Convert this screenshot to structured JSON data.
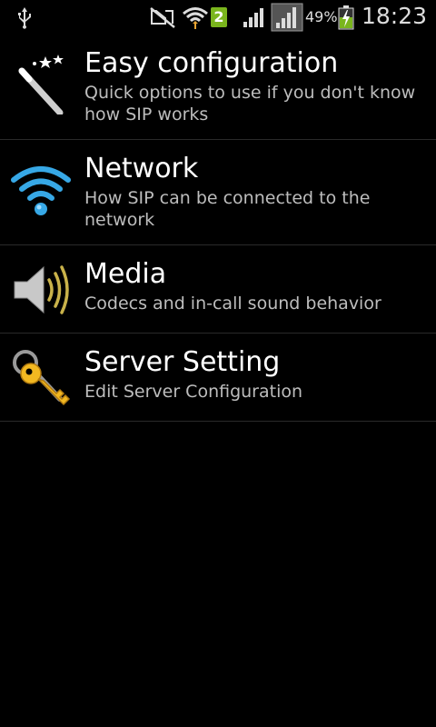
{
  "status_bar": {
    "usb_icon": "usb-icon",
    "sim_badge": "2",
    "battery_percent": "49%",
    "time": "18:23"
  },
  "menu": {
    "items": [
      {
        "title": "Easy configuration",
        "subtitle": "Quick options to use if you don't know how SIP works",
        "icon": "magic-wand-icon"
      },
      {
        "title": "Network",
        "subtitle": "How SIP can be connected to the network",
        "icon": "wifi-icon"
      },
      {
        "title": "Media",
        "subtitle": "Codecs and in-call sound behavior",
        "icon": "speaker-icon"
      },
      {
        "title": "Server Setting",
        "subtitle": "Edit Server Configuration",
        "icon": "keys-icon"
      }
    ]
  },
  "colors": {
    "background": "#000000",
    "title_text": "#ffffff",
    "subtitle_text": "#bdbdbd",
    "divider": "#2a2a2a",
    "sim_badge": "#7ab51d",
    "wifi_blue": "#37a8e6"
  }
}
